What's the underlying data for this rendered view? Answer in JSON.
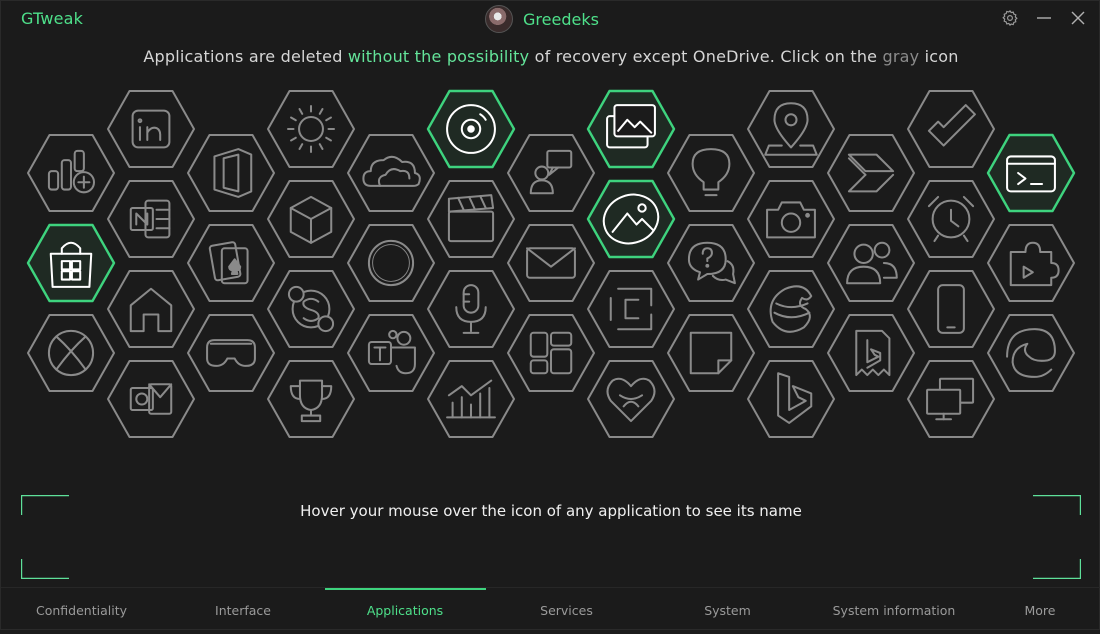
{
  "app": {
    "title": "GTweak",
    "user": "Greedeks"
  },
  "notice": {
    "part1": "Applications are deleted ",
    "highlight": "without the possibility",
    "part2": " of recovery except OneDrive. Click on the ",
    "gray_word": "gray",
    "part3": " icon"
  },
  "hint": "Hover your mouse over the icon of any application to see its name",
  "tabs": [
    {
      "label": "Confidentiality",
      "active": false
    },
    {
      "label": "Interface",
      "active": false
    },
    {
      "label": "Applications",
      "active": true
    },
    {
      "label": "Services",
      "active": false
    },
    {
      "label": "System",
      "active": false
    },
    {
      "label": "System information",
      "active": false
    },
    {
      "label": "More",
      "active": false
    }
  ],
  "colors": {
    "accent": "#4ee08a",
    "hex_gray": "#8a8a8a",
    "hex_active": "#3ed37e",
    "background": "#1b1b1b"
  },
  "apps": [
    {
      "icon": "widgets-add-icon",
      "active": false
    },
    {
      "icon": "microsoft-store-icon",
      "active": true
    },
    {
      "icon": "xbox-icon",
      "active": false
    },
    {
      "icon": "linkedin-icon",
      "active": false
    },
    {
      "icon": "onenote-icon",
      "active": false
    },
    {
      "icon": "home-icon",
      "active": false
    },
    {
      "icon": "outlook-icon",
      "active": false
    },
    {
      "icon": "office-icon",
      "active": false
    },
    {
      "icon": "solitaire-cards-icon",
      "active": false
    },
    {
      "icon": "mixed-reality-headset-icon",
      "active": false
    },
    {
      "icon": "weather-sun-icon",
      "active": false
    },
    {
      "icon": "3d-cube-icon",
      "active": false
    },
    {
      "icon": "skype-icon",
      "active": false
    },
    {
      "icon": "trophy-icon",
      "active": false
    },
    {
      "icon": "onedrive-cloud-icon",
      "active": false
    },
    {
      "icon": "cortana-ring-icon",
      "active": false
    },
    {
      "icon": "teams-icon",
      "active": false
    },
    {
      "icon": "groove-music-disc-icon",
      "active": true
    },
    {
      "icon": "movies-clapperboard-icon",
      "active": false
    },
    {
      "icon": "voice-recorder-microphone-icon",
      "active": false
    },
    {
      "icon": "power-bi-chart-icon",
      "active": false
    },
    {
      "icon": "feedback-hub-icon",
      "active": false
    },
    {
      "icon": "mail-envelope-icon",
      "active": false
    },
    {
      "icon": "quick-assist-grid-icon",
      "active": false
    },
    {
      "icon": "photos-gallery-icon",
      "active": true
    },
    {
      "icon": "photo-editor-icon",
      "active": true
    },
    {
      "icon": "clipchamp-icon",
      "active": false
    },
    {
      "icon": "clipchamp-heart-icon",
      "active": false
    },
    {
      "icon": "tips-lightbulb-icon",
      "active": false
    },
    {
      "icon": "get-help-chat-icon",
      "active": false
    },
    {
      "icon": "sticky-notes-icon",
      "active": false
    },
    {
      "icon": "maps-pin-icon",
      "active": false
    },
    {
      "icon": "camera-icon",
      "active": false
    },
    {
      "icon": "paint-3d-icon",
      "active": false
    },
    {
      "icon": "bing-icon",
      "active": false
    },
    {
      "icon": "power-automate-icon",
      "active": false
    },
    {
      "icon": "people-contacts-icon",
      "active": false
    },
    {
      "icon": "bing-news-icon",
      "active": false
    },
    {
      "icon": "todo-check-icon",
      "active": false
    },
    {
      "icon": "alarms-clock-icon",
      "active": false
    },
    {
      "icon": "phone-link-icon",
      "active": false
    },
    {
      "icon": "remote-desktop-icon",
      "active": false
    },
    {
      "icon": "terminal-icon",
      "active": true
    },
    {
      "icon": "power-apps-puzzle-icon",
      "active": false
    },
    {
      "icon": "edge-icon",
      "active": false
    }
  ]
}
